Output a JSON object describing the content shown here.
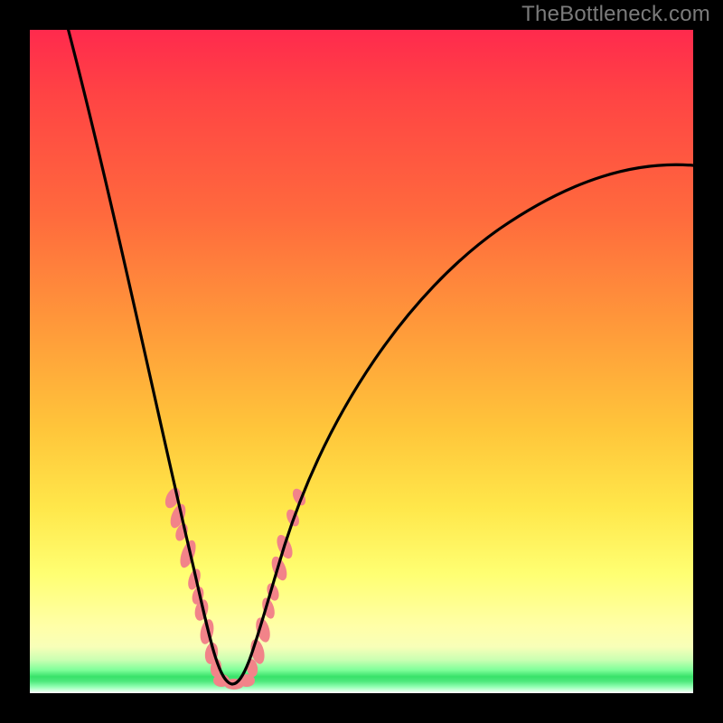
{
  "watermark": "TheBottleneck.com",
  "colors": {
    "gradient_top": "#ff2a4d",
    "gradient_mid1": "#ff7a3a",
    "gradient_mid2": "#ffd23a",
    "gradient_low": "#ffff7a",
    "green_bar": "#39e26a",
    "curve": "#000000",
    "blob": "#f28389",
    "frame": "#000000"
  },
  "chart_data": {
    "type": "line",
    "title": "",
    "xlabel": "",
    "ylabel": "",
    "xlim": [
      0,
      100
    ],
    "ylim": [
      0,
      100
    ],
    "series": [
      {
        "name": "bottleneck-curve",
        "x": [
          0,
          4,
          8,
          12,
          15,
          18,
          21,
          23.5,
          25.5,
          27,
          28,
          29,
          30,
          32,
          33,
          35,
          38,
          42,
          48,
          56,
          66,
          78,
          90,
          100
        ],
        "y": [
          100,
          88,
          76,
          64,
          54,
          44,
          34,
          24,
          15,
          8,
          3,
          0.5,
          0.5,
          3,
          6,
          12,
          20,
          30,
          42,
          53,
          62,
          69,
          74,
          77
        ]
      }
    ],
    "annotations": [
      {
        "name": "left-blob-cluster",
        "type": "scatter",
        "approx_x_range": [
          21,
          30
        ],
        "approx_y_range": [
          0,
          30
        ]
      },
      {
        "name": "right-blob-cluster",
        "type": "scatter",
        "approx_x_range": [
          30,
          37
        ],
        "approx_y_range": [
          0,
          30
        ]
      }
    ]
  }
}
